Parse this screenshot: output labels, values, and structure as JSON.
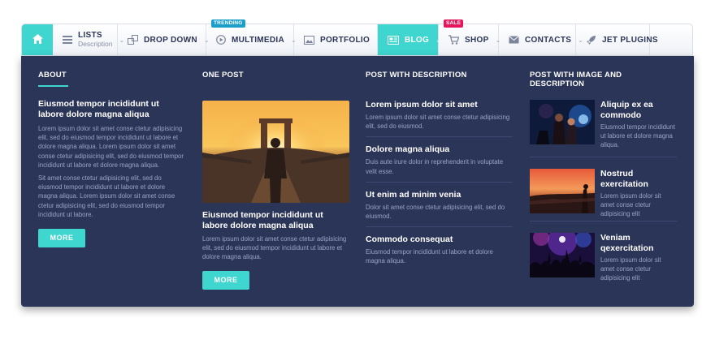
{
  "nav": {
    "items": [
      {
        "label": "LISTS",
        "sub": "Description"
      },
      {
        "label": "DROP DOWN"
      },
      {
        "label": "MULTIMEDIA",
        "badge": "TRENDING"
      },
      {
        "label": "PORTFOLIO"
      },
      {
        "label": "BLOG",
        "active": true
      },
      {
        "label": "SHOP",
        "badge": "SALE"
      },
      {
        "label": "CONTACTS"
      },
      {
        "label": "JET PLUGINS"
      }
    ]
  },
  "colors": {
    "accent": "#3fd6cf",
    "panel": "#2b3558",
    "trending": "#1b9fc8",
    "sale": "#e5175c"
  },
  "about": {
    "title": "ABOUT",
    "heading": "Eiusmod tempor incididunt ut labore dolore magna aliqua",
    "para1": "Lorem ipsum dolor sit amet conse ctetur adipisicing elit, sed do eiusmod tempor incididunt ut labore et dolore magna aliqua. Lorem ipsum dolor sit amet conse ctetur adipisicing elit, sed do eiusmod tempor incididunt ut labore et dolore magna aliqua.",
    "para2": "Sit amet conse ctetur adipisicing elit, sed do eiusmod tempor incididunt ut labore et dolore magna aliqua. Lorem ipsum dolor sit amet conse ctetur adipisicing elit, sed do eiusmod tempor incididunt ut labore.",
    "button": "MORE"
  },
  "one_post": {
    "title": "ONE POST",
    "heading": "Eiusmod tempor incididunt ut labore dolore magna aliqua",
    "text": "Lorem ipsum dolor sit amet conse ctetur adipisicing elit, sed do eiusmod tempor incididunt ut labore et dolore magna aliqua.",
    "button": "MORE"
  },
  "post_desc": {
    "title": "POST WITH DESCRIPTION",
    "items": [
      {
        "heading": "Lorem ipsum dolor sit amet",
        "text": "Lorem ipsum dolor sit amet conse ctetur adipisicing elit, sed do eiusmod."
      },
      {
        "heading": "Dolore magna aliqua",
        "text": "Duis aute irure dolor in reprehenderit in voluptate velit esse."
      },
      {
        "heading": "Ut enim ad minim venia",
        "text": "Dolor sit amet conse ctetur adipisicing elit, sed do eiusmod."
      },
      {
        "heading": "Commodo consequat",
        "text": "Eiusmod tempor incididunt ut labore et dolore magna aliqua."
      }
    ]
  },
  "post_img_desc": {
    "title": "POST WITH IMAGE AND DESCRIPTION",
    "items": [
      {
        "heading": "Aliquip ex ea commodo",
        "text": "Eiusmod tempor incididunt ut labore et dolore magna aliqua."
      },
      {
        "heading": "Nostrud exercitation",
        "text": "Lorem ipsum dolor sit amet conse ctetur adipisicing elit"
      },
      {
        "heading": "Veniam qexercitation",
        "text": "Lorem ipsum dolor sit amet conse ctetur adipisicing elit"
      }
    ]
  }
}
